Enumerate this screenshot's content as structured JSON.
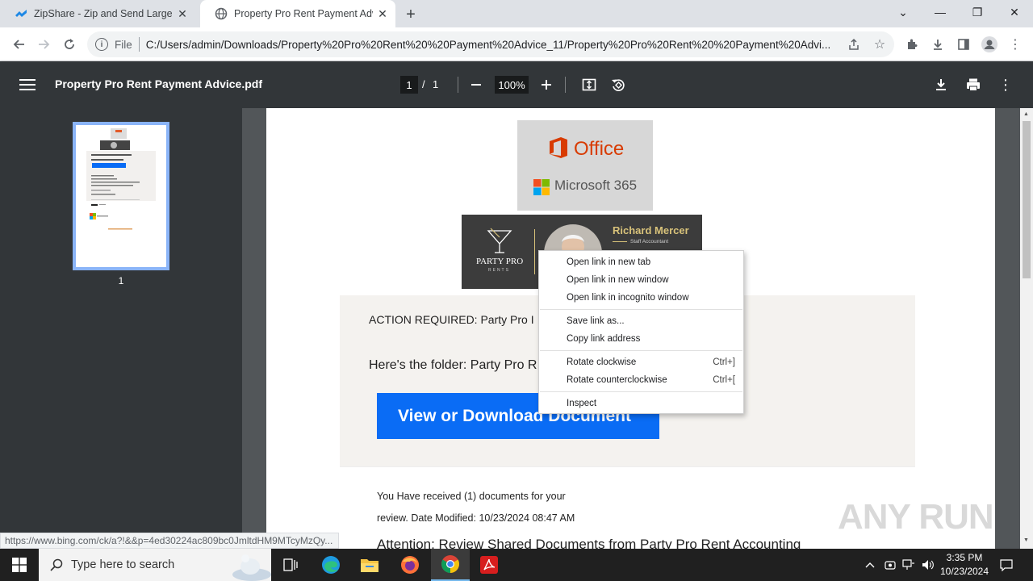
{
  "tabs": [
    {
      "title": "ZipShare - Zip and Send Large Fi",
      "close": "✕"
    },
    {
      "title": "Property Pro Rent Payment Advic",
      "close": "✕"
    }
  ],
  "new_tab": "+",
  "window_controls": {
    "dropdown": "⌄",
    "minimize": "—",
    "restore": "❐",
    "close": "✕"
  },
  "omnibox": {
    "scheme": "File",
    "url": "C:/Users/admin/Downloads/Property%20Pro%20Rent%20%20Payment%20Advice_11/Property%20Pro%20Rent%20%20Payment%20Advi..."
  },
  "pdf": {
    "title": "Property Pro Rent Payment Advice.pdf",
    "page_current": "1",
    "page_sep": "/",
    "page_total": "1",
    "zoom": "100%",
    "thumb_number": "1"
  },
  "document": {
    "office": "Office",
    "ms365": "Microsoft 365",
    "sig_name": "Richard Mercer",
    "sig_role": "Staff Accountant",
    "sig_brand": "PARTY PRO",
    "sig_brand_sub": "RENTS",
    "action_text": "ACTION REQUIRED: Party  Pro I",
    "folder_text": "Here's the folder: Party Pro R",
    "view_button": "View or Download Document",
    "received_line1": "You Have received (1) documents for your",
    "received_line2": "review. Date Modified: 10/23/2024 08:47 AM",
    "attention": "Attention: Review Shared Documents from Party Pro Rent Accounting"
  },
  "context_menu": {
    "items": [
      {
        "label": "Open link in new tab",
        "shortcut": ""
      },
      {
        "label": "Open link in new window",
        "shortcut": ""
      },
      {
        "label": "Open link in incognito window",
        "shortcut": ""
      },
      {
        "label": "Save link as...",
        "shortcut": ""
      },
      {
        "label": "Copy link address",
        "shortcut": ""
      },
      {
        "label": "Rotate clockwise",
        "shortcut": "Ctrl+]"
      },
      {
        "label": "Rotate counterclockwise",
        "shortcut": "Ctrl+["
      },
      {
        "label": "Inspect",
        "shortcut": ""
      }
    ]
  },
  "status_url": "https://www.bing.com/ck/a?!&&p=4ed30224ac809bc0JmltdHM9MTcyMzQy...",
  "watermark": "ANY RUN",
  "taskbar": {
    "search_placeholder": "Type here to search",
    "time": "3:35 PM",
    "date": "10/23/2024"
  }
}
